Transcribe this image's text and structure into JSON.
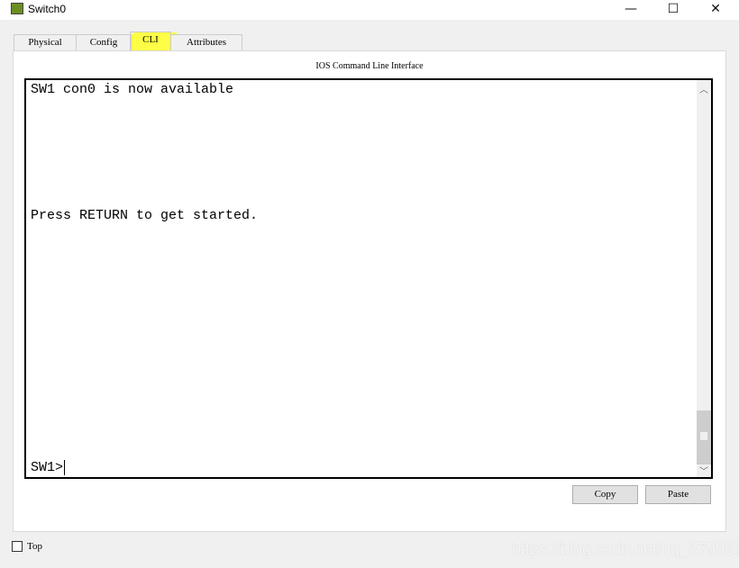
{
  "window": {
    "title": "Switch0",
    "minimize": "—",
    "maximize": "☐",
    "close": "✕"
  },
  "tabs": [
    {
      "label": "Physical"
    },
    {
      "label": "Config"
    },
    {
      "label": "CLI",
      "active": true
    },
    {
      "label": "Attributes"
    }
  ],
  "panel": {
    "title": "IOS Command Line Interface"
  },
  "terminal": {
    "lines": [
      "SW1 con0 is now available",
      "Press RETURN to get started."
    ],
    "prompt": "SW1>"
  },
  "buttons": {
    "copy": "Copy",
    "paste": "Paste"
  },
  "footer": {
    "top_label": "Top",
    "top_checked": false
  },
  "watermark": "https://blog.csdn.net/qq_37992321",
  "colors": {
    "highlight": "#ffff33"
  }
}
